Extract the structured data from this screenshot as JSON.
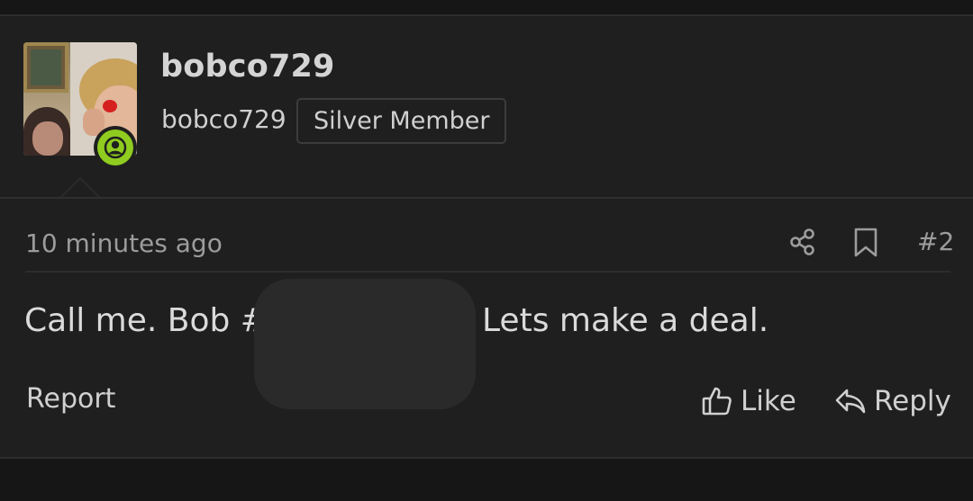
{
  "post": {
    "author": {
      "display_name": "bobco729",
      "username": "bobco729",
      "member_title": "Silver Member",
      "status_icon": "user-online-icon",
      "status_color": "#8fcc1f"
    },
    "meta": {
      "timestamp": "10 minutes ago",
      "post_number": "#2",
      "share_icon": "share-icon",
      "bookmark_icon": "bookmark-icon"
    },
    "message": {
      "before_redaction": "Call me. Bob #",
      "after_redaction": "Lets make a deal."
    },
    "actions": {
      "report_label": "Report",
      "like_label": "Like",
      "like_icon": "thumbs-up-icon",
      "reply_label": "Reply",
      "reply_icon": "reply-arrow-icon"
    }
  },
  "theme": {
    "background": "#1f1f1f",
    "text": "#d6d6d6",
    "muted_text": "#9c9c9c",
    "border": "#2f2f2f"
  }
}
